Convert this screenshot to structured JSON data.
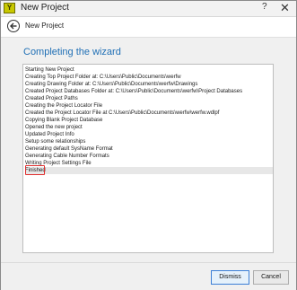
{
  "window": {
    "title": "New Project",
    "help_label": "?",
    "close_label": "✕"
  },
  "header": {
    "title": "New Project"
  },
  "main": {
    "heading": "Completing the wizard",
    "log_lines": [
      "Starting New Project",
      "Creating Top Project Folder at: C:\\Users\\Public\\Documents\\werfw",
      "Creating Drawing Folder at: C:\\Users\\Public\\Documents\\werfw\\Drawings",
      "Created Project Databases Folder at: C:\\Users\\Public\\Documents\\werfw\\Project Databases",
      "Created Project Paths",
      "Creating the Project Locator File",
      "Created the Project Locator File at C:\\Users\\Public\\Documents\\werfw\\werfw.wdlpf",
      "Copying Blank Project Database",
      "Opened the new project",
      "Updated Project Info",
      "Setup some relationships",
      "Generating default SysName Format",
      "Generating Cable Number Formats",
      "Writing Project Settings File",
      "Finished"
    ],
    "selected_line": "Finished"
  },
  "footer": {
    "dismiss_label": "Dismiss",
    "cancel_label": "Cancel"
  },
  "colors": {
    "heading": "#1f6fb5",
    "highlight": "#e03030"
  }
}
